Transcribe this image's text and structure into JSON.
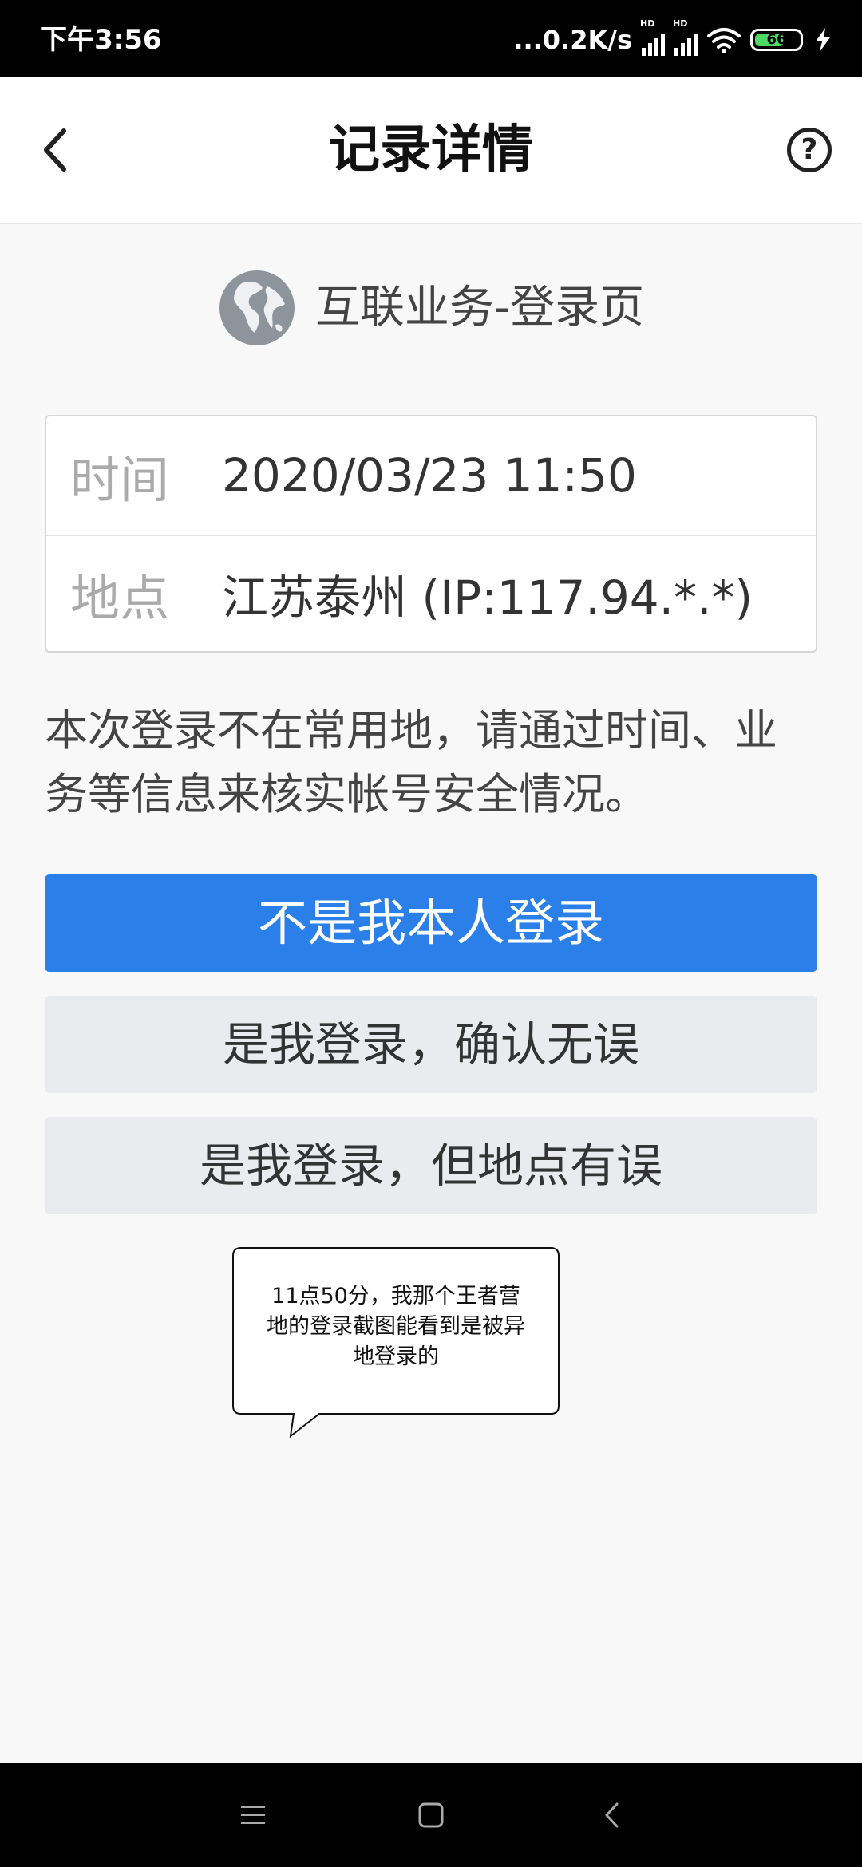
{
  "status_bar": {
    "time": "下午3:56",
    "network_speed": "...0.2K/s",
    "signal_1_label": "HD",
    "signal_2_label": "HD",
    "battery_level": "66",
    "battery_fraction": 0.66,
    "icons": [
      "signal-icon",
      "signal-icon",
      "wifi-icon",
      "battery-icon",
      "charging-icon"
    ]
  },
  "nav": {
    "title": "记录详情",
    "back_icon": "chevron-left-icon",
    "help_label": "?"
  },
  "service": {
    "icon": "globe-icon",
    "name": "互联业务-登录页"
  },
  "info": {
    "rows": [
      {
        "label": "时间",
        "value": "2020/03/23 11:50"
      },
      {
        "label": "地点",
        "value": "江苏泰州 (IP:117.94.*.*)"
      }
    ]
  },
  "notice": "本次登录不在常用地，请通过时间、业务等信息来核实帐号安全情况。",
  "buttons": {
    "not_me": "不是我本人登录",
    "confirm": "是我登录，确认无误",
    "location_wrong": "是我登录，但地点有误"
  },
  "bubble": {
    "text": "11点50分，我那个王者营地的登录截图能看到是被异地登录的"
  },
  "bottom_nav": {
    "icons": [
      "menu-icon",
      "home-icon",
      "back-icon"
    ]
  },
  "colors": {
    "primary": "#2a7fe8",
    "secondary_bg": "#e9ebee",
    "page_bg": "#f8f8f8",
    "battery_green": "#4cd964"
  }
}
